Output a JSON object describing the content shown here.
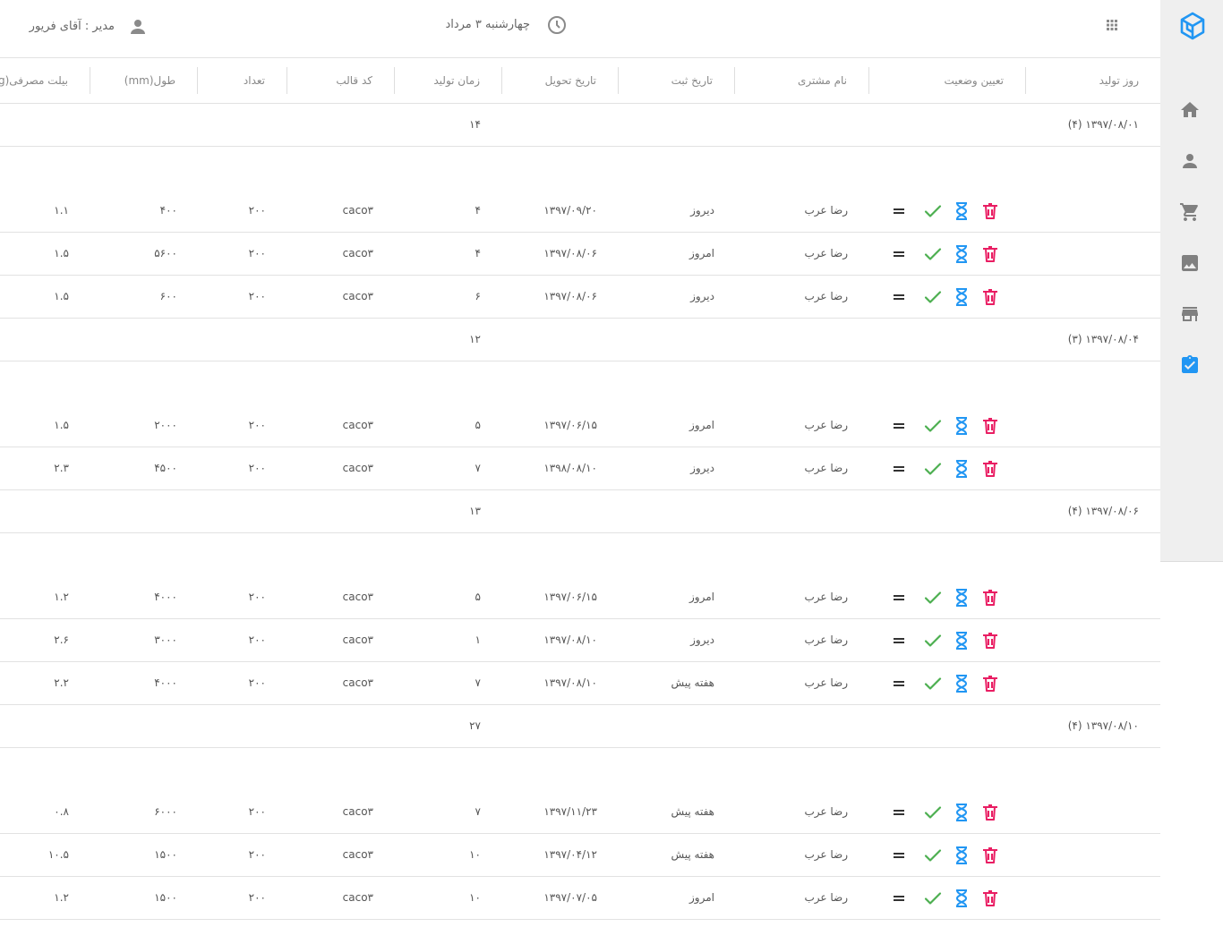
{
  "header": {
    "date": "چهارشنبه ۳ مرداد",
    "user": "مدیر : آقای فریور"
  },
  "icons": {
    "apps": "apps-grid-icon",
    "clock": "clock-icon",
    "user": "user-icon",
    "logo": "cube-logo-icon",
    "sidebar": [
      "home-icon",
      "person-icon",
      "cart-icon",
      "image-icon",
      "store-icon",
      "clipboard-check-icon"
    ]
  },
  "colors": {
    "accent": "#2196f3",
    "delete": "#e91e63",
    "check": "#4caf50",
    "equal": "#333333",
    "sidebar_icon": "#808080"
  },
  "columns": {
    "day": "روز تولید",
    "status": "تعیین وضعیت",
    "customer": "نام مشتری",
    "registered": "تاریخ ثبت",
    "delivery": "تاریخ تحویل",
    "time": "زمان تولید",
    "mold": "کد قالب",
    "count": "تعداد",
    "length": "طول(mm)",
    "billet": "بیلت مصرفی(kg)"
  },
  "groups": [
    {
      "label": "۱۳۹۷/۰۸/۰۱ (۴)",
      "total": "۱۴",
      "rows": [
        {
          "customer": "رضا عرب",
          "registered": "دیروز",
          "delivery": "۱۳۹۷/۰۹/۲۰",
          "time": "۴",
          "mold": "caco۳",
          "count": "۲۰۰",
          "length": "۴۰۰",
          "billet": "۱.۱"
        },
        {
          "customer": "رضا عرب",
          "registered": "امروز",
          "delivery": "۱۳۹۷/۰۸/۰۶",
          "time": "۴",
          "mold": "caco۳",
          "count": "۲۰۰",
          "length": "۵۶۰۰",
          "billet": "۱.۵"
        },
        {
          "customer": "رضا عرب",
          "registered": "دیروز",
          "delivery": "۱۳۹۷/۰۸/۰۶",
          "time": "۶",
          "mold": "caco۳",
          "count": "۲۰۰",
          "length": "۶۰۰",
          "billet": "۱.۵"
        }
      ]
    },
    {
      "label": "۱۳۹۷/۰۸/۰۴ (۳)",
      "total": "۱۲",
      "rows": [
        {
          "customer": "رضا عرب",
          "registered": "امروز",
          "delivery": "۱۳۹۷/۰۶/۱۵",
          "time": "۵",
          "mold": "caco۳",
          "count": "۲۰۰",
          "length": "۲۰۰۰",
          "billet": "۱.۵"
        },
        {
          "customer": "رضا عرب",
          "registered": "دیروز",
          "delivery": "۱۳۹۸/۰۸/۱۰",
          "time": "۷",
          "mold": "caco۳",
          "count": "۲۰۰",
          "length": "۴۵۰۰",
          "billet": "۲.۳"
        }
      ]
    },
    {
      "label": "۱۳۹۷/۰۸/۰۶ (۴)",
      "total": "۱۳",
      "rows": [
        {
          "customer": "رضا عرب",
          "registered": "امروز",
          "delivery": "۱۳۹۷/۰۶/۱۵",
          "time": "۵",
          "mold": "caco۳",
          "count": "۲۰۰",
          "length": "۴۰۰۰",
          "billet": "۱.۲"
        },
        {
          "customer": "رضا عرب",
          "registered": "دیروز",
          "delivery": "۱۳۹۷/۰۸/۱۰",
          "time": "۱",
          "mold": "caco۳",
          "count": "۲۰۰",
          "length": "۳۰۰۰",
          "billet": "۲.۶"
        },
        {
          "customer": "رضا عرب",
          "registered": "هفته پیش",
          "delivery": "۱۳۹۷/۰۸/۱۰",
          "time": "۷",
          "mold": "caco۳",
          "count": "۲۰۰",
          "length": "۴۰۰۰",
          "billet": "۲.۲"
        }
      ]
    },
    {
      "label": "۱۳۹۷/۰۸/۱۰ (۴)",
      "total": "۲۷",
      "rows": [
        {
          "customer": "رضا عرب",
          "registered": "هفته پیش",
          "delivery": "۱۳۹۷/۱۱/۲۳",
          "time": "۷",
          "mold": "caco۳",
          "count": "۲۰۰",
          "length": "۶۰۰۰",
          "billet": "۰.۸"
        },
        {
          "customer": "رضا عرب",
          "registered": "هفته پیش",
          "delivery": "۱۳۹۷/۰۴/۱۲",
          "time": "۱۰",
          "mold": "caco۳",
          "count": "۲۰۰",
          "length": "۱۵۰۰",
          "billet": "۱۰.۵"
        },
        {
          "customer": "رضا عرب",
          "registered": "امروز",
          "delivery": "۱۳۹۷/۰۷/۰۵",
          "time": "۱۰",
          "mold": "caco۳",
          "count": "۲۰۰",
          "length": "۱۵۰۰",
          "billet": "۱.۲"
        }
      ]
    }
  ]
}
